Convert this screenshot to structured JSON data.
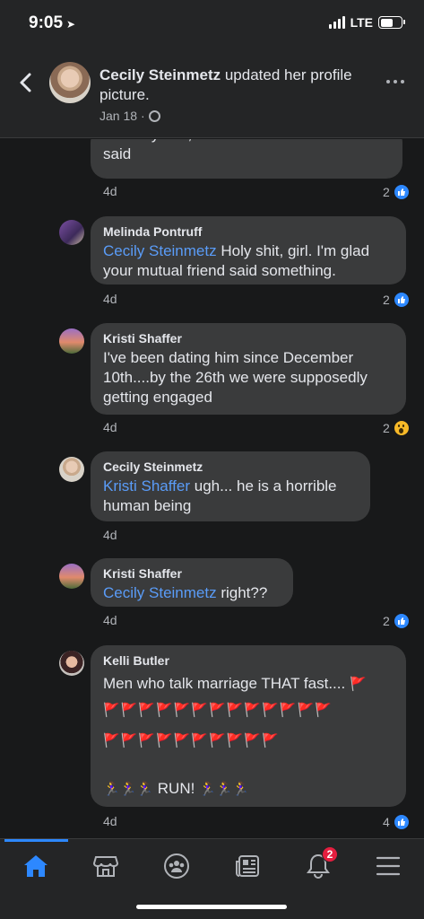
{
  "status_bar": {
    "time": "9:05",
    "network": "LTE"
  },
  "header": {
    "author": "Cecily Steinmetz",
    "action": " updated her profile picture.",
    "date": "Jan 18",
    "separator": "·"
  },
  "comments": [
    {
      "text": "to marry him, the sooner the better he said",
      "time": "4d",
      "reaction_count": "2",
      "reaction": "like"
    },
    {
      "author": "Melinda Pontruff",
      "mention": "Cecily Steinmetz",
      "text": " Holy shit, girl. I'm glad your mutual friend said something.",
      "time": "4d",
      "reaction_count": "2",
      "reaction": "like"
    },
    {
      "author": "Kristi Shaffer",
      "text": "I've been dating him since December 10th....by the 26th we were supposedly getting engaged",
      "time": "4d",
      "reaction_count": "2",
      "reaction": "wow"
    },
    {
      "author": "Cecily Steinmetz",
      "mention": "Kristi Shaffer",
      "text": " ugh... he is a horrible human being",
      "time": "4d"
    },
    {
      "author": "Kristi Shaffer",
      "mention": "Cecily Steinmetz",
      "text": " right??",
      "time": "4d",
      "reaction_count": "2",
      "reaction": "like"
    },
    {
      "author": "Kelli Butler",
      "text": "Men who talk marriage THAT fast....",
      "flags_row1": "🚩🚩🚩🚩🚩🚩🚩🚩🚩🚩🚩🚩🚩",
      "flags_row2": "🚩🚩🚩🚩🚩🚩🚩🚩🚩🚩",
      "runners_left": "🏃‍♀️🏃‍♀️🏃‍♀️",
      "run_text": "RUN!",
      "runners_right": "🏃‍♀️🏃‍♀️🏃‍♀️",
      "flag_end": "🚩",
      "time": "4d",
      "reaction_count": "4",
      "reaction": "like"
    }
  ],
  "bottom_nav": {
    "items": [
      "home-icon",
      "marketplace-icon",
      "groups-icon",
      "news-icon",
      "notifications-icon",
      "menu-icon"
    ],
    "notification_badge": "2"
  },
  "colors": {
    "accent": "#2d88ff",
    "mention": "#5a9cf8",
    "badge": "#e41e3f",
    "bubble": "#3a3b3c",
    "background": "#18191a"
  }
}
